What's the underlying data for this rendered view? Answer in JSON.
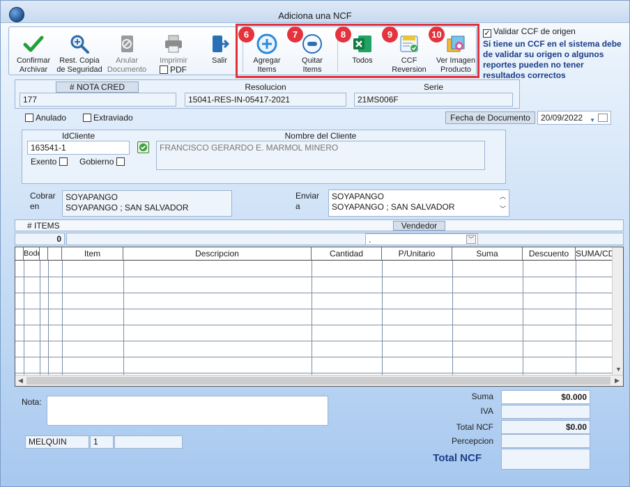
{
  "window": {
    "title": "Adiciona una NCF"
  },
  "toolbar": {
    "confirmar": "Confirmar\nArchivar",
    "rest_copia": "Rest. Copia\nde Seguridad",
    "anular": "Anular\nDocumento",
    "imprimir": "Imprimir",
    "pdf": "PDF",
    "salir": "Salir",
    "agregar": "Agregar\nItems",
    "quitar": "Quitar\nItems",
    "todos": "Todos",
    "ccf_reversion": "CCF\nReversion",
    "ver_imagen": "Ver Imagen\nProducto",
    "badges": [
      "6",
      "7",
      "8",
      "9",
      "10"
    ]
  },
  "validar": {
    "label": "Validar CCF de origen",
    "checked": true,
    "note": "Si tiene un CCF en el sistema debe de validar su origen o algunos reportes pueden no tener resultados correctos"
  },
  "doc": {
    "nota_cred_label": "# NOTA CRED",
    "nota_cred_value": "177",
    "resolucion_label": "Resolucion",
    "resolucion_value": "15041-RES-IN-05417-2021",
    "serie_label": "Serie",
    "serie_value": "21MS006F",
    "anulado": "Anulado",
    "extraviado": "Extraviado",
    "fecha_label": "Fecha de  Documento",
    "fecha_value": "20/09/2022"
  },
  "cliente": {
    "id_label": "IdCliente",
    "id_value": "163541-1",
    "nombre_label": "Nombre del Cliente",
    "nombre_value": "FRANCISCO GERARDO E. MARMOL MINERO",
    "exento": "Exento",
    "gobierno": "Gobierno"
  },
  "cobrar": {
    "label1": "Cobrar",
    "label2": "en",
    "line1": "SOYAPANGO",
    "line2": "SOYAPANGO ; SAN SALVADOR"
  },
  "enviar": {
    "label1": "Enviar",
    "label2": "a",
    "line1": "SOYAPANGO",
    "line2": "SOYAPANGO ; SAN SALVADOR"
  },
  "items": {
    "items_label": "# ITEMS",
    "items_count": "0",
    "vendedor_label": "Vendedor",
    "vendedor_value": "."
  },
  "grid": {
    "columns": [
      "Bodega",
      "",
      "",
      "Item",
      "Descripcion",
      "Cantidad",
      "P/Unitario",
      "Suma",
      "Descuento",
      "SUMA/CD"
    ]
  },
  "nota": {
    "label": "Nota:",
    "value": ""
  },
  "footer": {
    "user": "MELQUIN",
    "num": "1",
    "extra": ""
  },
  "totals": {
    "suma_label": "Suma",
    "suma_value": "$0.000",
    "iva_label": "IVA",
    "iva_value": "",
    "total_ncf_label": "Total NCF",
    "total_ncf_value": "$0.00",
    "percepcion_label": "Percepcion",
    "percepcion_value": "",
    "total_big_label": "Total NCF",
    "total_big_value": ""
  }
}
